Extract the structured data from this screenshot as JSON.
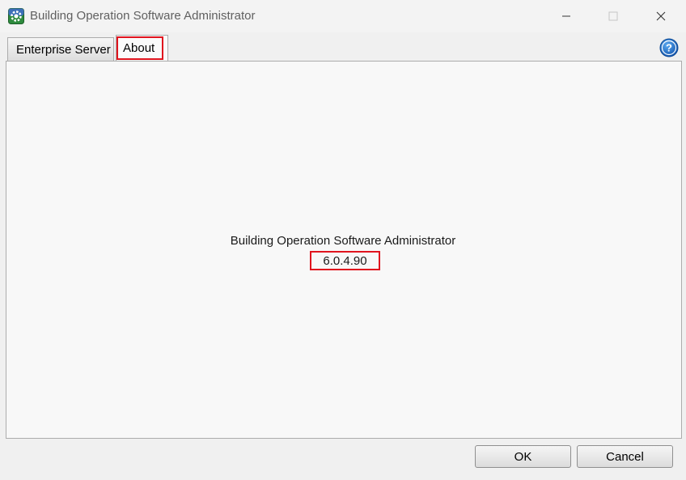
{
  "window": {
    "title": "Building Operation Software Administrator"
  },
  "tabs": [
    {
      "label": "Enterprise Server",
      "selected": false
    },
    {
      "label": "About",
      "selected": true
    }
  ],
  "about": {
    "product_name": "Building Operation Software Administrator",
    "version": "6.0.4.90"
  },
  "buttons": {
    "ok": "OK",
    "cancel": "Cancel"
  },
  "icons": {
    "app": "app-gear-icon",
    "help": "help-icon",
    "minimize": "minimize-icon",
    "maximize": "maximize-icon",
    "close": "close-icon"
  },
  "colors": {
    "highlight": "#e0141e",
    "help_blue": "#1e6fd0"
  }
}
